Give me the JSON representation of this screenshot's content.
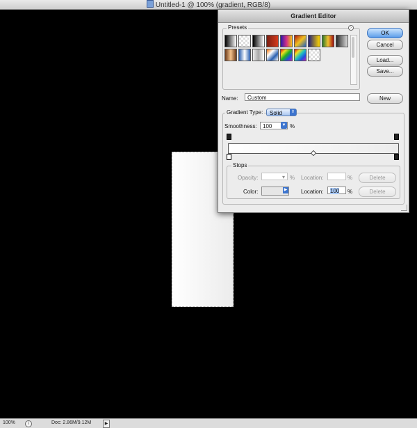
{
  "window": {
    "title": "Untitled-1 @ 100% (gradient, RGB/8)",
    "icon": "photoshop-document-icon"
  },
  "statusbar": {
    "zoom": "100%",
    "doc_info": "Doc: 2.86M/9.12M",
    "info_icon": "info-icon",
    "arrow_icon": "triangle-right-icon"
  },
  "dialog": {
    "title": "Gradient Editor",
    "presets_label": "Presets",
    "preset_swatches": [
      "linear-gradient(to right,#000,#fff)",
      "repeating-conic-gradient(#ddd 0 25%,#fff 0 50%) 0 0/6px 6px",
      "linear-gradient(to right,#000,#fff)",
      "linear-gradient(to right,#7a1f12,#d63a1c)",
      "linear-gradient(to right,#2a19a8,#cf2d8a,#f0c018)",
      "linear-gradient(135deg,#b01810,#f0c020,#2060c0)",
      "linear-gradient(to right,#1f1f7a,#ffd500)",
      "linear-gradient(to right,#2a7a2a,#f0c030,#a01010)",
      "linear-gradient(to right,#2a2a2a,#d9d9d9)",
      "linear-gradient(to right,#6b3b1b,#f4c28c,#6b3b1b)",
      "linear-gradient(to right,#2a5fb0,#fff,#2a5fb0)",
      "linear-gradient(to right,#e8e8e8,#a8a8a8,#fff)",
      "linear-gradient(135deg,#f06f00,#fff,#2a5fb0,#fff)",
      "linear-gradient(135deg,#e01010,#f0e020,#20b020,#2050e0,#c020c0)",
      "linear-gradient(135deg,#e01010,#f0e020,#20c0c0,#2050e0,#c020c0)",
      "repeating-conic-gradient(#ddd 0 25%,#fff 0 50%) 0 0/6px 6px"
    ],
    "buttons": {
      "ok": "OK",
      "cancel": "Cancel",
      "load": "Load...",
      "save": "Save...",
      "new": "New"
    },
    "name_label": "Name:",
    "name_value": "Custom",
    "gradient_type_label": "Gradient Type:",
    "gradient_type_value": "Solid",
    "smoothness_label": "Smoothness:",
    "smoothness_value": "100",
    "smoothness_unit": "%",
    "gradient_colors": {
      "start": "#ffffff",
      "end": "#ececec"
    },
    "stops": {
      "label": "Stops",
      "opacity_label": "Opacity:",
      "opacity_value": "",
      "opacity_unit": "%",
      "opacity_location_label": "Location:",
      "opacity_location_value": "",
      "opacity_location_unit": "%",
      "opacity_delete": "Delete",
      "color_label": "Color:",
      "color_location_label": "Location:",
      "color_location_value": "100",
      "color_location_unit": "%",
      "color_delete": "Delete"
    }
  }
}
